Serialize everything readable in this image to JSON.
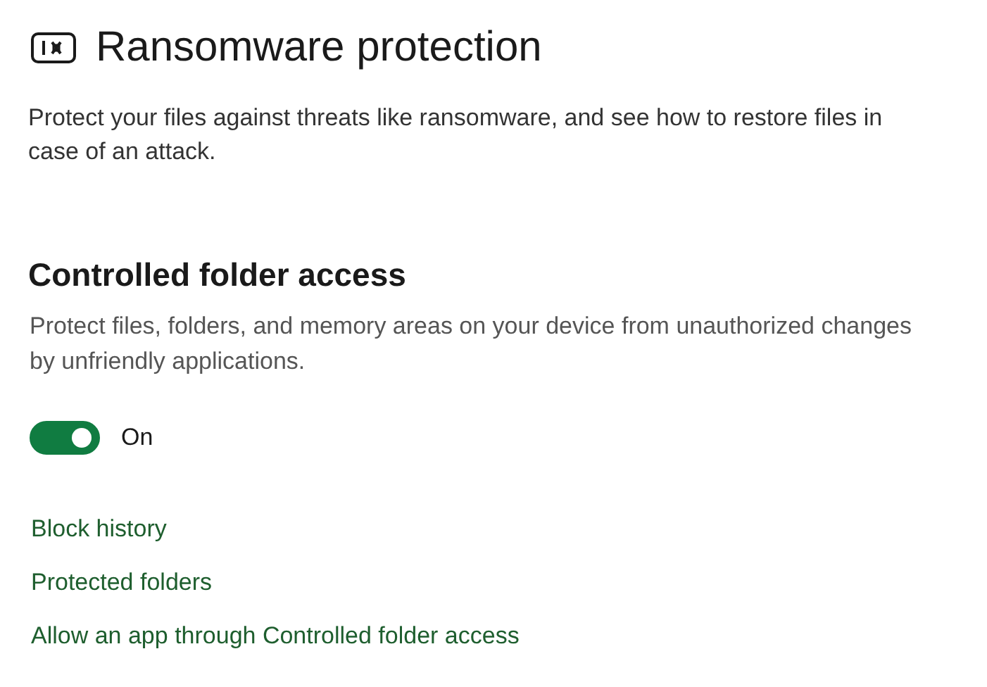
{
  "page": {
    "title": "Ransomware protection",
    "description": "Protect your files against threats like ransomware, and see how to restore files in case of an attack."
  },
  "section": {
    "heading": "Controlled folder access",
    "description": "Protect files, folders, and memory areas on your device from unauthorized changes by unfriendly applications."
  },
  "toggle": {
    "on": true,
    "label": "On"
  },
  "links": [
    "Block history",
    "Protected folders",
    "Allow an app through Controlled folder access"
  ]
}
